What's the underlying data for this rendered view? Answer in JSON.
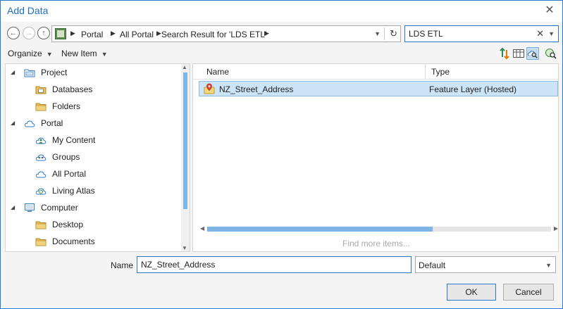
{
  "window": {
    "title": "Add Data",
    "close_glyph": "✕"
  },
  "nav": {
    "back_glyph": "←",
    "forward_glyph": "→",
    "up_glyph": "↑",
    "breadcrumbs": [
      "Portal",
      "All Portal",
      "Search Result for 'LDS ETL'"
    ],
    "refresh_glyph": "↻"
  },
  "search": {
    "value": "LDS ETL",
    "clear_glyph": "✕"
  },
  "toolbar": {
    "organize_label": "Organize",
    "new_item_label": "New Item",
    "caret_glyph": "▼"
  },
  "tree": {
    "items": [
      {
        "label": "Project",
        "level": 0,
        "expanded": true,
        "icon": "project-icon"
      },
      {
        "label": "Databases",
        "level": 1,
        "icon": "database-icon"
      },
      {
        "label": "Folders",
        "level": 1,
        "icon": "folder-icon"
      },
      {
        "label": "Portal",
        "level": 0,
        "expanded": true,
        "icon": "cloud-icon"
      },
      {
        "label": "My Content",
        "level": 1,
        "icon": "my-content-icon"
      },
      {
        "label": "Groups",
        "level": 1,
        "icon": "groups-icon"
      },
      {
        "label": "All Portal",
        "level": 1,
        "icon": "cloud-icon"
      },
      {
        "label": "Living Atlas",
        "level": 1,
        "icon": "living-atlas-icon"
      },
      {
        "label": "Computer",
        "level": 0,
        "expanded": true,
        "icon": "computer-icon"
      },
      {
        "label": "Desktop",
        "level": 1,
        "icon": "folder-icon"
      },
      {
        "label": "Documents",
        "level": 1,
        "icon": "folder-icon"
      }
    ]
  },
  "list": {
    "columns": {
      "name": "Name",
      "type": "Type"
    },
    "rows": [
      {
        "name": "NZ_Street_Address",
        "type": "Feature Layer (Hosted)",
        "icon": "feature-layer-icon",
        "selected": true
      }
    ],
    "find_more": "Find more items..."
  },
  "footer": {
    "name_label": "Name",
    "name_value": "NZ_Street_Address",
    "filter_value": "Default",
    "ok_label": "OK",
    "cancel_label": "Cancel"
  },
  "colors": {
    "accent": "#2b79c6",
    "title": "#1c6fc0",
    "selection": "#cce4f7",
    "folder": "#e8c35c"
  }
}
